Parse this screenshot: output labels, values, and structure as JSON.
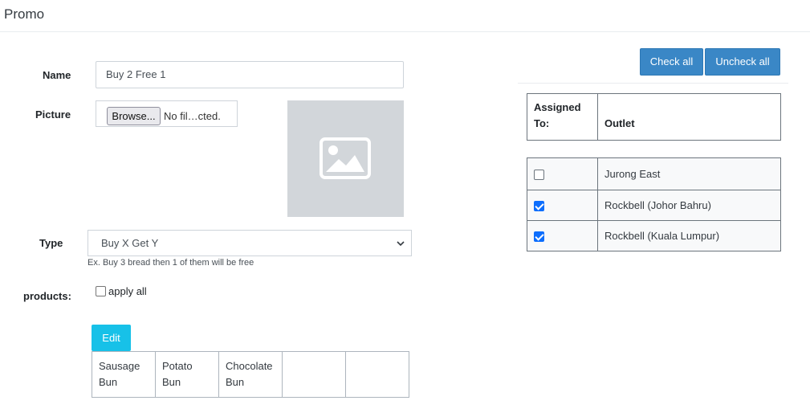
{
  "header": {
    "title": "Promo"
  },
  "form": {
    "name_label": "Name",
    "name_value": "Buy 2 Free 1",
    "picture_label": "Picture",
    "browse_label": "Browse...",
    "file_status": "No fil…cted.",
    "picture_placeholder_icon": "image-icon",
    "type_label": "Type",
    "type_selected": "Buy X Get Y",
    "type_hint": "Ex. Buy 3 bread then 1 of them will be free",
    "products_label": "products:",
    "apply_all_label": "apply all",
    "apply_all_checked": false,
    "edit_label": "Edit",
    "products": [
      "Sausage Bun",
      "Potato Bun",
      "Chocolate Bun",
      "",
      ""
    ]
  },
  "outlets": {
    "check_all_label": "Check all",
    "uncheck_all_label": "Uncheck all",
    "col_assigned": "Assigned To:",
    "col_outlet": "Outlet",
    "rows": [
      {
        "name": "Jurong East",
        "checked": false
      },
      {
        "name": "Rockbell (Johor Bahru)",
        "checked": true
      },
      {
        "name": "Rockbell (Kuala Lumpur)",
        "checked": true
      }
    ]
  }
}
